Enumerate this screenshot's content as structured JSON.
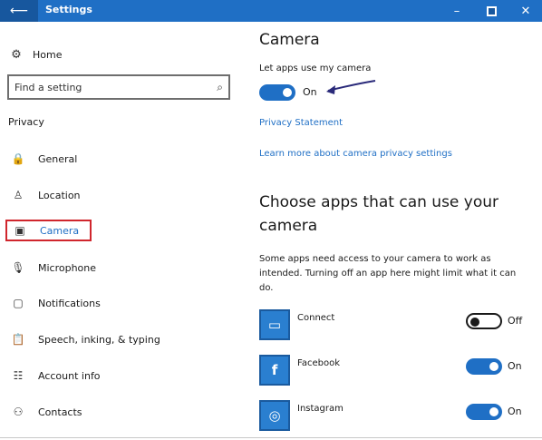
{
  "window": {
    "title": "Settings",
    "back_icon": "back-arrow-icon",
    "minimize_glyph": "–",
    "close_glyph": "✕",
    "accent_color": "#1f6fc5"
  },
  "sidebar": {
    "home": {
      "label": "Home",
      "icon": "gear-icon",
      "glyph": "⚙"
    },
    "search": {
      "placeholder": "Find a setting",
      "icon": "search-icon",
      "glyph": "⌕"
    },
    "section_label": "Privacy",
    "items": [
      {
        "label": "General",
        "icon": "lock-icon",
        "glyph": "🔒"
      },
      {
        "label": "Location",
        "icon": "location-icon",
        "glyph": "♙"
      },
      {
        "label": "Camera",
        "icon": "camera-icon",
        "glyph": "▣",
        "selected": true
      },
      {
        "label": "Microphone",
        "icon": "microphone-icon",
        "glyph": "🎙"
      },
      {
        "label": "Notifications",
        "icon": "notifications-icon",
        "glyph": "▢"
      },
      {
        "label": "Speech, inking, & typing",
        "icon": "speech-icon",
        "glyph": "📋"
      },
      {
        "label": "Account info",
        "icon": "account-info-icon",
        "glyph": "☷"
      },
      {
        "label": "Contacts",
        "icon": "contacts-icon",
        "glyph": "⚇"
      }
    ]
  },
  "main": {
    "title": "Camera",
    "let_apps_label": "Let apps use my camera",
    "main_toggle": {
      "state": "On",
      "on": true
    },
    "privacy_link": "Privacy Statement",
    "learn_more_link": "Learn more about camera privacy settings",
    "choose_heading": "Choose apps that can use your camera",
    "description": "Some apps need access to your camera to work as intended. Turning off an app here might limit what it can do.",
    "apps": [
      {
        "name": "Connect",
        "state": "Off",
        "on": false,
        "icon": "connect-app-icon",
        "glyph": "▭"
      },
      {
        "name": "Facebook",
        "state": "On",
        "on": true,
        "icon": "facebook-app-icon",
        "glyph": "f"
      },
      {
        "name": "Instagram",
        "state": "On",
        "on": true,
        "icon": "instagram-app-icon",
        "glyph": "◎"
      }
    ]
  }
}
